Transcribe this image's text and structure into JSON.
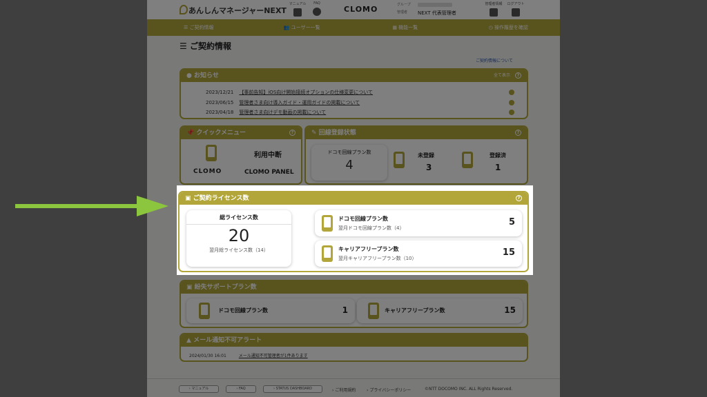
{
  "header": {
    "app_name": "あんしんマネージャーNEXT",
    "manual_label": "マニュアル",
    "faq_label": "FAQ",
    "clomo_logo": "CLOMO",
    "group_label": "グループ",
    "manager_label": "管理者",
    "manager_value": "NEXT 代表管理者",
    "admin_label": "管理者情報",
    "logout_label": "ログアウト"
  },
  "nav": {
    "items": [
      {
        "label": "ご契約情報",
        "icon": "list-icon"
      },
      {
        "label": "ユーザー一覧",
        "icon": "users-icon"
      },
      {
        "label": "機能一覧",
        "icon": "grid-icon"
      },
      {
        "label": "操作履歴を確認",
        "icon": "clock-icon"
      }
    ]
  },
  "page": {
    "title": "ご契約情報",
    "contract_link": "ご契約情報について"
  },
  "news": {
    "title": "お知らせ",
    "show_all": "全て表示",
    "items": [
      {
        "date": "2023/12/21",
        "text": "【事前告知】iOS向け開始接続オプションの仕様変更について"
      },
      {
        "date": "2023/06/15",
        "text": "管理者さま向け導入ガイド・運用ガイドの掲載について"
      },
      {
        "date": "2023/04/18",
        "text": "管理者さま向けデモ動画の掲載について"
      }
    ]
  },
  "quick": {
    "title": "クイックメニュー",
    "status_text": "利用中断",
    "clomo_logo": "CLOMO",
    "panel_text": "CLOMO PANEL"
  },
  "line_status": {
    "title": "回線登録状態",
    "docomo_label": "ドコモ回線プラン数",
    "docomo_value": "4",
    "unregistered_label": "未登録",
    "unregistered_value": "3",
    "registered_label": "登録済",
    "registered_value": "1"
  },
  "license": {
    "title": "ご契約ライセンス数",
    "total_label": "総ライセンス数",
    "total_value": "20",
    "total_next": "翌月総ライセンス数（14）",
    "docomo_label": "ドコモ回線プラン数",
    "docomo_next": "翌月ドコモ回線プラン数（4）",
    "docomo_value": "5",
    "carrier_label": "キャリアフリープラン数",
    "carrier_next": "翌月キャリアフリープラン数（10）",
    "carrier_value": "15"
  },
  "lost_support": {
    "title": "紛失サポートプラン数",
    "docomo_label": "ドコモ回線プラン数",
    "docomo_value": "1",
    "carrier_label": "キャリアフリープラン数",
    "carrier_value": "15"
  },
  "alert": {
    "title": "メール通知不可アラート",
    "date": "2024/01/30 16:01",
    "text": "メール通知不可管理者が1件あります"
  },
  "footer": {
    "manual": "マニュアル",
    "faq": "FAQ",
    "status": "STATUS DASHBOARD",
    "terms": "ご利用規約",
    "privacy": "プライバシーポリシー",
    "copyright": "©NTT DOCOMO INC. ALL Rights Reserved."
  },
  "colors": {
    "accent": "#b2a63a",
    "arrow": "#8cc63f"
  }
}
